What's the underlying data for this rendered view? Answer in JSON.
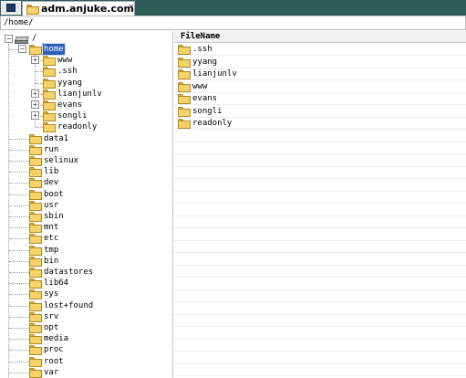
{
  "tab": {
    "title": "adm.anjuke.com",
    "close": "×"
  },
  "path": "/home/",
  "tree": {
    "root_label": "/",
    "home_label": "home",
    "home_children": [
      "www",
      ".ssh",
      "yyang",
      "lianjunlv",
      "evans",
      "songli",
      "readonly"
    ],
    "home_children_expandable": [
      true,
      false,
      false,
      true,
      true,
      true,
      false
    ],
    "root_children": [
      "data1",
      "run",
      "selinux",
      "lib",
      "dev",
      "boot",
      "usr",
      "sbin",
      "mnt",
      "etc",
      "tmp",
      "bin",
      "datastores",
      "lib64",
      "sys",
      "lost+found",
      "srv",
      "opt",
      "media",
      "proc",
      "root",
      "var"
    ]
  },
  "list": {
    "header": "FileName",
    "files": [
      ".ssh",
      "yyang",
      "lianjunlv",
      "www",
      "evans",
      "songli",
      "readonly"
    ]
  },
  "colors": {
    "tabbar": "#2f5e58",
    "selection": "#2c5fb8",
    "folder": "#f6d36a"
  }
}
